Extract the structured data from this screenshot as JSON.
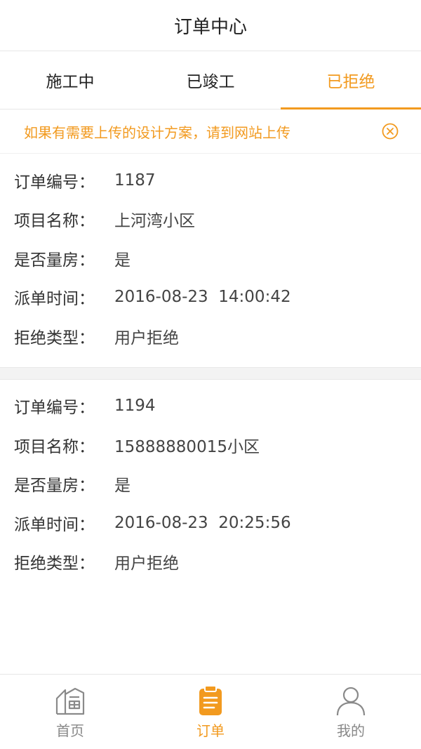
{
  "header": {
    "title": "订单中心"
  },
  "tabs": [
    {
      "label": "施工中"
    },
    {
      "label": "已竣工"
    },
    {
      "label": "已拒绝"
    }
  ],
  "notice": {
    "text": "如果有需要上传的设计方案，请到网站上传"
  },
  "orders": [
    {
      "fields": [
        {
          "label": "订单编号：",
          "value": "1187"
        },
        {
          "label": "项目名称：",
          "value": "上河湾小区"
        },
        {
          "label": "是否量房：",
          "value": "是"
        },
        {
          "label": "派单时间：",
          "value": "2016-08-23  14:00:42"
        },
        {
          "label": "拒绝类型：",
          "value": "用户拒绝"
        }
      ]
    },
    {
      "fields": [
        {
          "label": "订单编号：",
          "value": "1194"
        },
        {
          "label": "项目名称：",
          "value": "15888880015小区"
        },
        {
          "label": "是否量房：",
          "value": "是"
        },
        {
          "label": "派单时间：",
          "value": "2016-08-23  20:25:56"
        },
        {
          "label": "拒绝类型：",
          "value": "用户拒绝"
        }
      ]
    }
  ],
  "tabbar": [
    {
      "label": "首页",
      "icon": "home-building-icon"
    },
    {
      "label": "订单",
      "icon": "clipboard-icon"
    },
    {
      "label": "我的",
      "icon": "user-icon"
    }
  ],
  "colors": {
    "accent": "#f29a1f",
    "inactive": "#888888"
  }
}
